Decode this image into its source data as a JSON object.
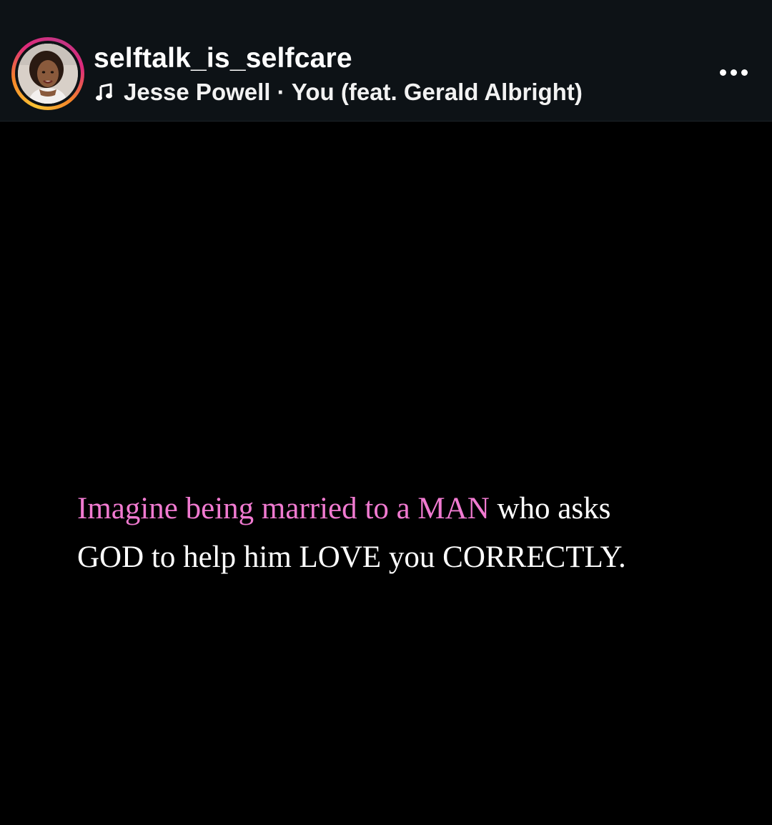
{
  "post_header": {
    "username": "selftalk_is_selfcare",
    "audio_artist": "Jesse Powell",
    "audio_separator": " · ",
    "audio_title": "You (feat. Gerald Albright)",
    "avatar_icon": "profile-photo",
    "music_icon": "music-note-icon",
    "more_icon": "more-horizontal-icon",
    "story_ring_colors": [
      "#f9c434",
      "#f58529",
      "#dd2a7b",
      "#c13584"
    ]
  },
  "media": {
    "caption_line1_pink": "Imagine being married to a MAN",
    "caption_line1_white": " who asks",
    "caption_line2_white": "GOD to help him LOVE you CORRECTLY.",
    "highlight_color": "#f07ad0",
    "text_color": "#ffffff",
    "background_color": "#000000"
  }
}
